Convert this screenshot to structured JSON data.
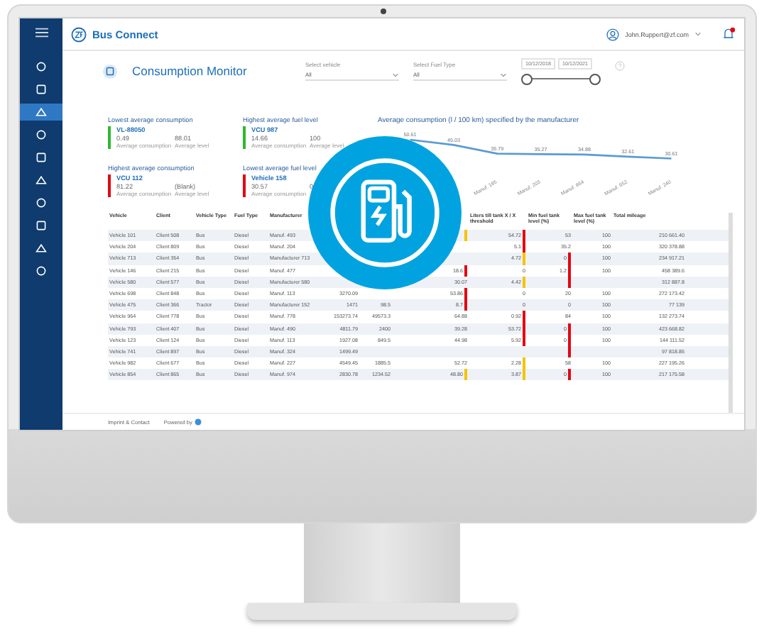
{
  "header": {
    "app_name": "Bus Connect",
    "user": "John.Ruppert@zf.com",
    "notification": true
  },
  "sidebar": {
    "items": [
      {
        "selected": false
      },
      {
        "selected": false
      },
      {
        "selected": true
      },
      {
        "selected": false
      },
      {
        "selected": false
      },
      {
        "selected": false
      },
      {
        "selected": false
      },
      {
        "selected": false
      },
      {
        "selected": false
      },
      {
        "selected": false
      }
    ]
  },
  "page_title": "Consumption Monitor",
  "filters": [
    {
      "label": "Select vehicle",
      "value": "All"
    },
    {
      "label": "Select Fuel Type",
      "value": "All"
    }
  ],
  "date_range": {
    "from": "10/12/2018",
    "to": "10/12/2021",
    "knobs": [
      {
        "level": 0
      },
      {
        "level": 1
      }
    ]
  },
  "kpis": [
    {
      "title": "Lowest average consumption",
      "name": "VL-88050",
      "color": "#2eb82e",
      "v1": "0.49",
      "l1": "Average consumption",
      "v2": "88.01",
      "l2": "Average level"
    },
    {
      "title": "Highest average fuel level",
      "name": "VCU 987",
      "color": "#2eb82e",
      "v1": "14.66",
      "l1": "Average consumption",
      "v2": "100",
      "l2": "Average level"
    },
    {
      "title": "Highest average consumption",
      "name": "VCU 112",
      "color": "#e30613",
      "v1": "81.22",
      "l1": "Average consumption",
      "v2": "(Blank)",
      "l2": "Average level"
    },
    {
      "title": "Lowest average fuel level",
      "name": "Vehicle 158",
      "color": "#e30613",
      "v1": "30.57",
      "l1": "Average consumption",
      "v2": "0"
    }
  ],
  "chart": {
    "chart_data": {
      "type": "line",
      "title": "Average consumption (l / 100 km) specified by the manufacturer",
      "categories": [
        null,
        null,
        "Manuf. 185",
        "Manuf. 203",
        "Manuf. 864",
        "Manuf. 652",
        "Manuf. 240"
      ],
      "series": [
        {
          "color": "#5a9bd5",
          "values": [
            50.61,
            45.03,
            35.79,
            35.27,
            34.88,
            32.61,
            30.61
          ]
        }
      ],
      "data_labels": true
    }
  },
  "table": {
    "columns": [
      {
        "label": "Vehicle"
      },
      {
        "label": "Client"
      },
      {
        "label": "Vehicle Type"
      },
      {
        "label": "Fuel Type"
      },
      {
        "label": "Manufacturer"
      },
      {},
      {},
      {},
      {
        "label": "Liters till tank X / X threshold"
      },
      {
        "label": "Min fuel tank level (%)"
      },
      {
        "label": "Max fuel tank level (%)"
      },
      {
        "label": "Total mileage"
      }
    ],
    "rows": [
      {
        "cells": [
          {
            "text": "Vehicle 101"
          },
          {
            "text": "Client 508"
          },
          {
            "text": "Bus"
          },
          {
            "text": "Diesel"
          },
          {
            "text": "Manuf. 493"
          },
          {},
          {},
          {
            "color": "#f5c400"
          },
          {
            "text": "54.72",
            "color": "#e30613"
          },
          {
            "text": "53"
          },
          {
            "text": "100"
          },
          {
            "text": "210 661.40"
          }
        ]
      },
      {
        "cells": [
          {
            "text": "Vehicle 204"
          },
          {
            "text": "Client 809"
          },
          {
            "text": "Bus"
          },
          {
            "text": "Diesel"
          },
          {
            "text": "Manuf. 204"
          },
          {},
          {},
          {},
          {
            "text": "5.1",
            "color": "#e30613"
          },
          {
            "text": "35.2"
          },
          {
            "text": "100"
          },
          {
            "text": "320 378.88"
          }
        ]
      },
      {
        "cells": [
          {
            "text": "Vehicle 713"
          },
          {
            "text": "Client 354"
          },
          {
            "text": "Bus"
          },
          {
            "text": "Diesel"
          },
          {
            "text": "Manufacturer 713"
          },
          {},
          {},
          {},
          {
            "text": "4.72",
            "color": "#f5c400"
          },
          {
            "text": "0",
            "color": "#e30613"
          },
          {
            "text": "100"
          },
          {
            "text": "234 917.21"
          }
        ]
      },
      {
        "cells": [
          {
            "text": "Vehicle 146"
          },
          {
            "text": "Client 215"
          },
          {
            "text": "Bus"
          },
          {
            "text": "Diesel"
          },
          {
            "text": "Manuf. 477"
          },
          {},
          {},
          {
            "text": "18.6",
            "color": "#e30613"
          },
          {
            "text": "0"
          },
          {
            "text": "1.2",
            "color": "#e30613"
          },
          {
            "text": "100"
          },
          {
            "text": "458 389.6"
          }
        ]
      },
      {
        "cells": [
          {
            "text": "Vehicle 580"
          },
          {
            "text": "Client 577"
          },
          {
            "text": "Bus"
          },
          {
            "text": "Diesel"
          },
          {
            "text": "Manufacturer 580"
          },
          {},
          {},
          {
            "text": "30.07"
          },
          {
            "text": "4.42",
            "color": "#f5c400"
          },
          {
            "color": "#e30613"
          },
          {},
          {
            "text": "312 887.8"
          }
        ]
      },
      {
        "cells": [
          {
            "text": "Vehicle 698"
          },
          {
            "text": "Client 848"
          },
          {
            "text": "Bus"
          },
          {
            "text": "Diesel"
          },
          {
            "text": "Manuf. 113"
          },
          {
            "text": "3270.09"
          },
          {},
          {
            "text": "53.86",
            "color": "#e30613"
          },
          {
            "text": "0"
          },
          {
            "text": "20"
          },
          {
            "text": "100"
          },
          {
            "text": "272 173.42"
          }
        ]
      },
      {
        "cells": [
          {
            "text": "Vehicle 475"
          },
          {
            "text": "Client 366"
          },
          {
            "text": "Tractor"
          },
          {
            "text": "Diesel"
          },
          {
            "text": "Manufacturer 152"
          },
          {
            "text": "1471"
          },
          {
            "text": "98.5"
          },
          {
            "text": "8.7",
            "color": "#e30613"
          },
          {
            "text": "0"
          },
          {
            "text": "0"
          },
          {
            "text": "100"
          },
          {
            "text": "77 139"
          }
        ]
      },
      {
        "cells": [
          {
            "text": "Vehicle 964"
          },
          {
            "text": "Client 778"
          },
          {
            "text": "Bus"
          },
          {
            "text": "Diesel"
          },
          {
            "text": "Manuf. 778"
          },
          {
            "text": "153273.74"
          },
          {
            "text": "49573.3"
          },
          {
            "text": "64.88"
          },
          {
            "text": "0.92",
            "color": "#e30613"
          },
          {
            "text": "84"
          },
          {
            "text": "100"
          },
          {
            "text": "132 273.74"
          }
        ]
      },
      {
        "cells": [
          {
            "text": "Vehicle 793"
          },
          {
            "text": "Client 407"
          },
          {
            "text": "Bus"
          },
          {
            "text": "Diesel"
          },
          {
            "text": "Manuf. 490"
          },
          {
            "text": "4811.79"
          },
          {
            "text": "2400"
          },
          {
            "text": "39.28"
          },
          {
            "text": "53.72",
            "color": "#e30613"
          },
          {
            "text": "0",
            "color": "#e30613"
          },
          {
            "text": "100"
          },
          {
            "text": "423 668.82"
          }
        ]
      },
      {
        "cells": [
          {
            "text": "Vehicle 123"
          },
          {
            "text": "Client 124"
          },
          {
            "text": "Bus"
          },
          {
            "text": "Diesel"
          },
          {
            "text": "Manuf. 113"
          },
          {
            "text": "1927.08"
          },
          {
            "text": "849.5"
          },
          {
            "text": "44.98"
          },
          {
            "text": "5.92",
            "color": "#e30613"
          },
          {
            "text": "0",
            "color": "#e30613"
          },
          {
            "text": "100"
          },
          {
            "text": "144 111.52"
          }
        ]
      },
      {
        "cells": [
          {
            "text": "Vehicle 741"
          },
          {
            "text": "Client 897"
          },
          {
            "text": "Bus"
          },
          {
            "text": "Diesel"
          },
          {
            "text": "Manuf. 324"
          },
          {
            "text": "1499.49"
          },
          {},
          {},
          {},
          {
            "color": "#e30613"
          },
          {},
          {
            "text": "97 818.85"
          }
        ]
      },
      {
        "cells": [
          {
            "text": "Vehicle 982"
          },
          {
            "text": "Client 677"
          },
          {
            "text": "Bus"
          },
          {
            "text": "Diesel"
          },
          {
            "text": "Manuf. 227"
          },
          {
            "text": "4549.45"
          },
          {
            "text": "1885.5"
          },
          {
            "text": "52.72"
          },
          {
            "text": "2.28",
            "color": "#f5c400"
          },
          {
            "text": "58"
          },
          {
            "text": "100"
          },
          {
            "text": "227 195.26"
          }
        ]
      },
      {
        "cells": [
          {
            "text": "Vehicle 854"
          },
          {
            "text": "Client 865"
          },
          {
            "text": "Bus"
          },
          {
            "text": "Diesel"
          },
          {
            "text": "Manuf. 974"
          },
          {
            "text": "2830.78"
          },
          {
            "text": "1234.52"
          },
          {
            "text": "48.80",
            "color": "#f5c400"
          },
          {
            "text": "3.87",
            "color": "#f5c400"
          },
          {
            "text": "0",
            "color": "#e30613"
          },
          {
            "text": "100"
          },
          {
            "text": "217 175.58"
          }
        ]
      }
    ]
  },
  "footer": {
    "left": "Imprint & Contact",
    "powered": "Powered by"
  }
}
